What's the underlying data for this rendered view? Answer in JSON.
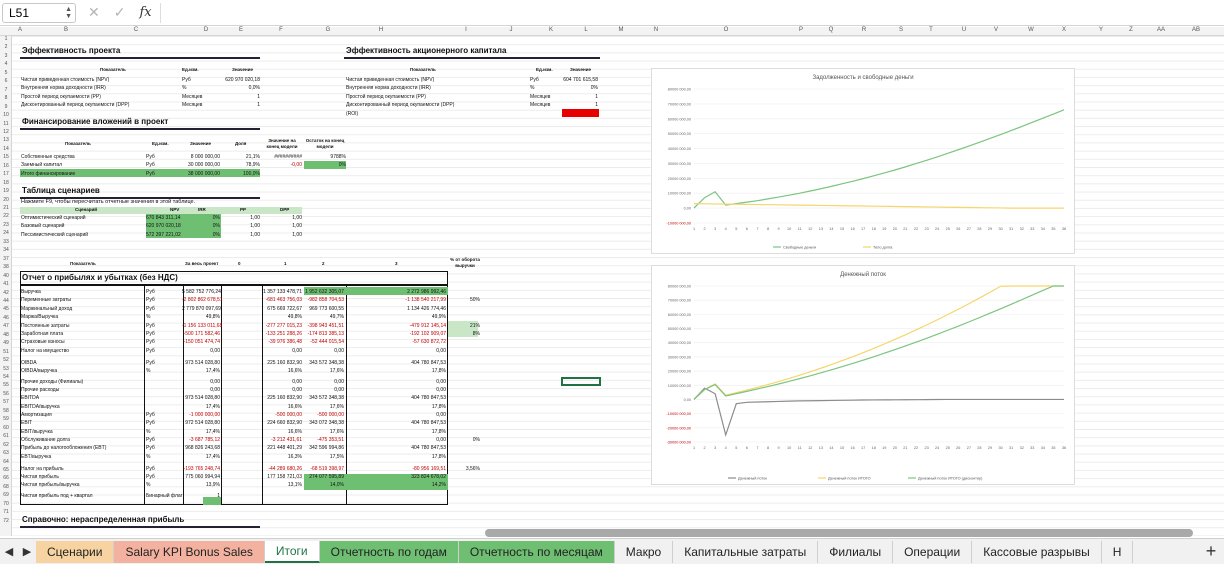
{
  "formula_bar": {
    "cell_ref": "L51",
    "fx": "fx",
    "cancel": "✕",
    "confirm": "✓"
  },
  "columns": [
    "A",
    "B",
    "C",
    "D",
    "E",
    "F",
    "G",
    "H",
    "I",
    "J",
    "K",
    "L",
    "M",
    "N",
    "O",
    "P",
    "Q",
    "R",
    "S",
    "T",
    "U",
    "V",
    "W",
    "X",
    "Y",
    "Z",
    "AA",
    "AB"
  ],
  "rows": [
    "1",
    "2",
    "3",
    "4",
    "5",
    "6",
    "7",
    "8",
    "9",
    "10",
    "11",
    "12",
    "13",
    "14",
    "15",
    "16",
    "17",
    "18",
    "19",
    "20",
    "21",
    "22",
    "23",
    "24",
    "33",
    "34",
    "37",
    "38",
    "40",
    "41",
    "42",
    "44",
    "45",
    "46",
    "47",
    "48",
    "49",
    "51",
    "52",
    "53",
    "54",
    "55",
    "56",
    "57",
    "58",
    "59",
    "60",
    "61",
    "62",
    "63",
    "64",
    "65",
    "66",
    "68",
    "69",
    "70",
    "71",
    "72"
  ],
  "project": {
    "title": "Эффективность проекта",
    "header": [
      "Показатель",
      "Ед.изм.",
      "Значение"
    ],
    "rows": [
      [
        "Чистая приведенная стоимость (NPV)",
        "Руб",
        "620 970 020,18"
      ],
      [
        "Внутренняя норма доходности (IRR)",
        "%",
        "0,0%"
      ],
      [
        "Простой период окупаемости (PP)",
        "Месяцев",
        "1"
      ],
      [
        "Дисконтированный период окупаемости (DPP)",
        "Месяцев",
        "1"
      ]
    ]
  },
  "equity": {
    "title": "Эффективность акционерного капитала",
    "header": [
      "Показатель",
      "Ед.изм.",
      "Значение"
    ],
    "rows": [
      [
        "Чистая приведенная стоимость (NPV)",
        "Руб",
        "604 701 615,58"
      ],
      [
        "Внутренняя норма доходности (IRR)",
        "%",
        "0%"
      ],
      [
        "Простой период окупаемости (PP)",
        "Месяцев",
        "1"
      ],
      [
        "Дисконтированный период окупаемости (DPP)",
        "Месяцев",
        "1"
      ],
      [
        "(ROI)",
        "",
        ""
      ]
    ]
  },
  "financing": {
    "title": "Финансирование вложений в проект",
    "header": [
      "Показатель",
      "Ед.изм.",
      "Значение",
      "Доля",
      "Значение на конец модели",
      "Остаток на конец модели"
    ],
    "rows": [
      [
        "Собственные средства",
        "Руб",
        "8 000 000,00",
        "21,1%",
        "##########",
        "9788%"
      ],
      [
        "Заемный капитал",
        "Руб",
        "30 000 000,00",
        "78,9%",
        "-0,00",
        "0%"
      ],
      [
        "Итого финансирование",
        "Руб",
        "38 000 000,00",
        "100,0%",
        "",
        ""
      ]
    ]
  },
  "scenarios": {
    "title": "Таблица сценариев",
    "note": "Нажмите F9, чтобы пересчитать отчетные значения в этой таблице.",
    "header": [
      "Сценарий",
      "NPV",
      "IRR",
      "PP",
      "DPP"
    ],
    "rows": [
      [
        "Оптимистический сценарий",
        "670 843 311,14",
        "0%",
        "1,00",
        "1,00"
      ],
      [
        "Базовый сценарий",
        "620 970 020,18",
        "0%",
        "1,00",
        "1,00"
      ],
      [
        "Пессимистический сценарий",
        "572 397 221,02",
        "0%",
        "1,00",
        "1,00"
      ]
    ]
  },
  "pnl": {
    "header": [
      "Показатель",
      "За весь проект",
      "0",
      "1",
      "2",
      "3",
      "% от оборота выручки"
    ],
    "title": "Отчет о прибылях и убытках (без НДС)",
    "rows": [
      [
        "Выручка",
        "Руб",
        "5 582 752 776,24",
        "",
        "1 357 133 478,71",
        "1 952 632 305,07",
        "2 272 986 992,46",
        "",
        false
      ],
      [
        "Переменные затраты",
        "Руб",
        "-2 802 862 678,51",
        "",
        "-681 463 756,03",
        "-982 858 704,53",
        "-1 138 540 217,99",
        "50%",
        true
      ],
      [
        "Маржинальный доход",
        "Руб",
        "2 779 870 097,69",
        "",
        "675 669 722,67",
        "969 773 600,55",
        "1 134 426 774,46",
        "",
        false
      ],
      [
        "Маржа/Выручка",
        "%",
        "49,8%",
        "",
        "49,8%",
        "49,7%",
        "49,9%",
        "",
        false
      ],
      [
        "Постоянные затраты",
        "Руб",
        "-1 156 133 011,68",
        "",
        "-277 277 015,23",
        "-398 943 451,51",
        "-479 912 145,14",
        "21%",
        true
      ],
      [
        "Заработная плата",
        "Руб",
        "-500 171 582,46",
        "",
        "-133 251 288,26",
        "-174 813 385,13",
        "-192 102 909,07",
        "8%",
        true
      ],
      [
        "Страховые взносы",
        "Руб",
        "-150 051 474,74",
        "",
        "-39 976 386,48",
        "-52 444 015,54",
        "-57 630 872,72",
        "",
        true
      ],
      [
        "Налог на имущество",
        "Руб",
        "0,00",
        "",
        "0,00",
        "0,00",
        "0,00",
        "",
        false
      ],
      [
        "OIBDA",
        "Руб",
        "973 514 028,80",
        "",
        "225 160 832,90",
        "343 572 348,38",
        "404 780 847,53",
        "",
        false
      ],
      [
        "OIBDA/выручка",
        "%",
        "17,4%",
        "",
        "16,6%",
        "17,6%",
        "17,8%",
        "",
        false
      ],
      [
        "Прочие доходы (Филиалы)",
        "",
        "0,00",
        "",
        "0,00",
        "0,00",
        "0,00",
        "",
        false
      ],
      [
        "Прочие расходы",
        "",
        "0,00",
        "",
        "0,00",
        "0,00",
        "0,00",
        "",
        false
      ],
      [
        "EBITDA",
        "",
        "973 514 028,80",
        "",
        "225 160 832,90",
        "343 572 348,38",
        "404 780 847,53",
        "",
        false
      ],
      [
        "EBITDA/выручка",
        "",
        "17,4%",
        "",
        "16,6%",
        "17,6%",
        "17,8%",
        "",
        false
      ],
      [
        "Амортизация",
        "Руб",
        "-1 000 000,00",
        "",
        "-500 000,00",
        "-500 000,00",
        "0,00",
        "",
        true
      ],
      [
        "EBIT",
        "Руб",
        "972 514 028,80",
        "",
        "224 660 832,90",
        "343 072 348,38",
        "404 780 847,53",
        "",
        false
      ],
      [
        "EBIT/выручка",
        "%",
        "17,4%",
        "",
        "16,6%",
        "17,6%",
        "17,8%",
        "",
        false
      ],
      [
        "Обслуживание долга",
        "Руб",
        "-3 687 785,12",
        "",
        "-3 212 431,61",
        "-475 353,51",
        "0,00",
        "0%",
        true
      ],
      [
        "Прибыль до налогообложения (EBT)",
        "Руб",
        "968 826 243,68",
        "",
        "221 448 401,29",
        "342 596 994,86",
        "404 780 847,53",
        "",
        false
      ],
      [
        "EBT/выручка",
        "%",
        "17,4%",
        "",
        "16,3%",
        "17,5%",
        "17,8%",
        "",
        false
      ],
      [
        "Налог на прибыль",
        "Руб",
        "-193 765 248,74",
        "",
        "-44 289 680,26",
        "-68 519 398,97",
        "-80 956 169,51",
        "3,56%",
        true
      ],
      [
        "Чистая прибыль",
        "Руб",
        "775 060 994,94",
        "",
        "177 158 721,03",
        "274 077 595,89",
        "323 824 678,02",
        "",
        false
      ],
      [
        "Чистая прибыль/выручка",
        "%",
        "13,9%",
        "",
        "13,1%",
        "14,0%",
        "14,2%",
        "",
        false
      ],
      [
        "Чистая прибыль под + квартал",
        "Бинарный флаг",
        "1",
        "",
        "",
        "",
        "",
        "",
        false
      ]
    ]
  },
  "retained": {
    "title": "Справочно: нераспределенная прибыль"
  },
  "chart_debt": {
    "title": "Задолженность и свободные деньги",
    "type": "line",
    "ytick_labels": [
      "80000 000,00",
      "70000 000,00",
      "60000 000,00",
      "50000 000,00",
      "40000 000,00",
      "30000 000,00",
      "20000 000,00",
      "10000 000,00",
      "0,00",
      "-10000 000,00"
    ],
    "legend": [
      "Свободные деньги",
      "Тело долга"
    ]
  },
  "chart_cash": {
    "title": "Денежный поток",
    "type": "line",
    "ytick_labels": [
      "80000 000,00",
      "70000 000,00",
      "60000 000,00",
      "50000 000,00",
      "40000 000,00",
      "30000 000,00",
      "20000 000,00",
      "10000 000,00",
      "0,00",
      "-10000 000,00",
      "-20000 000,00",
      "-30000 000,00"
    ],
    "legend": [
      "Денежный поток",
      "Денежный поток ИТОГО",
      "Денежный поток ИТОГО (дисконтир)"
    ]
  },
  "chart_data": [
    {
      "type": "line",
      "title": "Задолженность и свободные деньги",
      "x": [
        1,
        2,
        3,
        4,
        5,
        6,
        7,
        8,
        9,
        10,
        11,
        12,
        13,
        14,
        15,
        16,
        17,
        18,
        19,
        20,
        21,
        22,
        23,
        24,
        25,
        26,
        27,
        28,
        29,
        30,
        31,
        32,
        33,
        34,
        35,
        36
      ],
      "ylim": [
        -10000000,
        80000000
      ],
      "series": [
        {
          "name": "Свободные деньги",
          "color": "#7cc47f",
          "values": [
            0,
            7000000,
            11000000,
            2000000,
            3000000,
            4000000,
            5000000,
            6200000,
            7400000,
            8700000,
            10000000,
            11500000,
            13000000,
            14600000,
            16300000,
            18000000,
            19800000,
            21700000,
            23600000,
            25600000,
            27700000,
            29900000,
            32100000,
            34400000,
            36800000,
            39200000,
            41700000,
            44200000,
            46800000,
            49400000,
            52100000,
            54800000,
            57600000,
            60400000,
            63200000,
            66000000
          ]
        },
        {
          "name": "Тело долга",
          "color": "#f6d56b",
          "values": [
            3000000,
            2900000,
            2800000,
            2700000,
            2600000,
            2500000,
            2400000,
            2300000,
            2200000,
            2100000,
            2000000,
            1900000,
            1800000,
            1700000,
            1600000,
            1500000,
            1400000,
            1300000,
            1200000,
            1100000,
            1000000,
            900000,
            800000,
            700000,
            600000,
            500000,
            400000,
            300000,
            200000,
            100000,
            0,
            0,
            0,
            0,
            0,
            0
          ]
        }
      ]
    },
    {
      "type": "line",
      "title": "Денежный поток",
      "x": [
        1,
        2,
        3,
        4,
        5,
        6,
        7,
        8,
        9,
        10,
        11,
        12,
        13,
        14,
        15,
        16,
        17,
        18,
        19,
        20,
        21,
        22,
        23,
        24,
        25,
        26,
        27,
        28,
        29,
        30,
        31,
        32,
        33,
        34,
        35,
        36
      ],
      "ylim": [
        -30000000,
        80000000
      ],
      "series": [
        {
          "name": "Денежный поток",
          "color": "#8c8c8c",
          "values": [
            0,
            8000000,
            4000000,
            -25000000,
            -3000000,
            -2000000,
            -1800000,
            -1600000,
            -1400000,
            -1200000,
            -1000000,
            -900000,
            -800000,
            -700000,
            -600000,
            -500000,
            -400000,
            -350000,
            -300000,
            -250000,
            -200000,
            -150000,
            -100000,
            -50000,
            0,
            0,
            0,
            0,
            0,
            0,
            0,
            0,
            0,
            0,
            0,
            0
          ]
        },
        {
          "name": "Денежный поток ИТОГО",
          "color": "#f6d56b",
          "values": [
            0,
            7000000,
            11000000,
            3000000,
            4800000,
            6600000,
            8500000,
            10500000,
            12600000,
            14800000,
            17100000,
            19500000,
            22000000,
            24600000,
            27300000,
            30100000,
            33000000,
            36000000,
            39100000,
            42300000,
            45600000,
            49000000,
            52500000,
            56100000,
            59800000,
            63600000,
            67500000,
            71500000,
            75600000,
            79800000,
            84100000,
            88500000,
            93000000,
            97600000,
            102300000,
            107100000
          ]
        },
        {
          "name": "Денежный поток ИТОГО (дисконтир)",
          "color": "#7cc47f",
          "values": [
            0,
            7000000,
            10500000,
            2500000,
            4100000,
            5700000,
            7400000,
            9100000,
            10900000,
            12800000,
            14700000,
            16700000,
            18800000,
            20900000,
            23100000,
            25400000,
            27700000,
            30100000,
            32600000,
            35100000,
            37700000,
            40400000,
            43100000,
            45900000,
            48800000,
            51700000,
            54700000,
            57700000,
            60800000,
            63900000,
            67100000,
            70300000,
            73600000,
            76900000,
            80300000,
            83700000
          ]
        }
      ]
    }
  ],
  "tabs": [
    {
      "label": "Сценарии",
      "color": "#f6d3a0",
      "active": false
    },
    {
      "label": "Salary KPI Bonus Sales",
      "color": "#f3b2a0",
      "active": false
    },
    {
      "label": "Итоги",
      "color": "#ffffff",
      "active": true
    },
    {
      "label": "Отчетность по годам",
      "color": "#6fbf73",
      "active": false
    },
    {
      "label": "Отчетность по месяцам",
      "color": "#6fbf73",
      "active": false
    },
    {
      "label": "Макро",
      "color": "",
      "active": false
    },
    {
      "label": "Капитальные затраты",
      "color": "",
      "active": false
    },
    {
      "label": "Филиалы",
      "color": "",
      "active": false
    },
    {
      "label": "Операции",
      "color": "",
      "active": false
    },
    {
      "label": "Кассовые разрывы",
      "color": "",
      "active": false
    },
    {
      "label": "Н",
      "color": "",
      "active": false
    }
  ],
  "tab_nav": {
    "prev": "◀",
    "next": "▶",
    "add": "+"
  }
}
